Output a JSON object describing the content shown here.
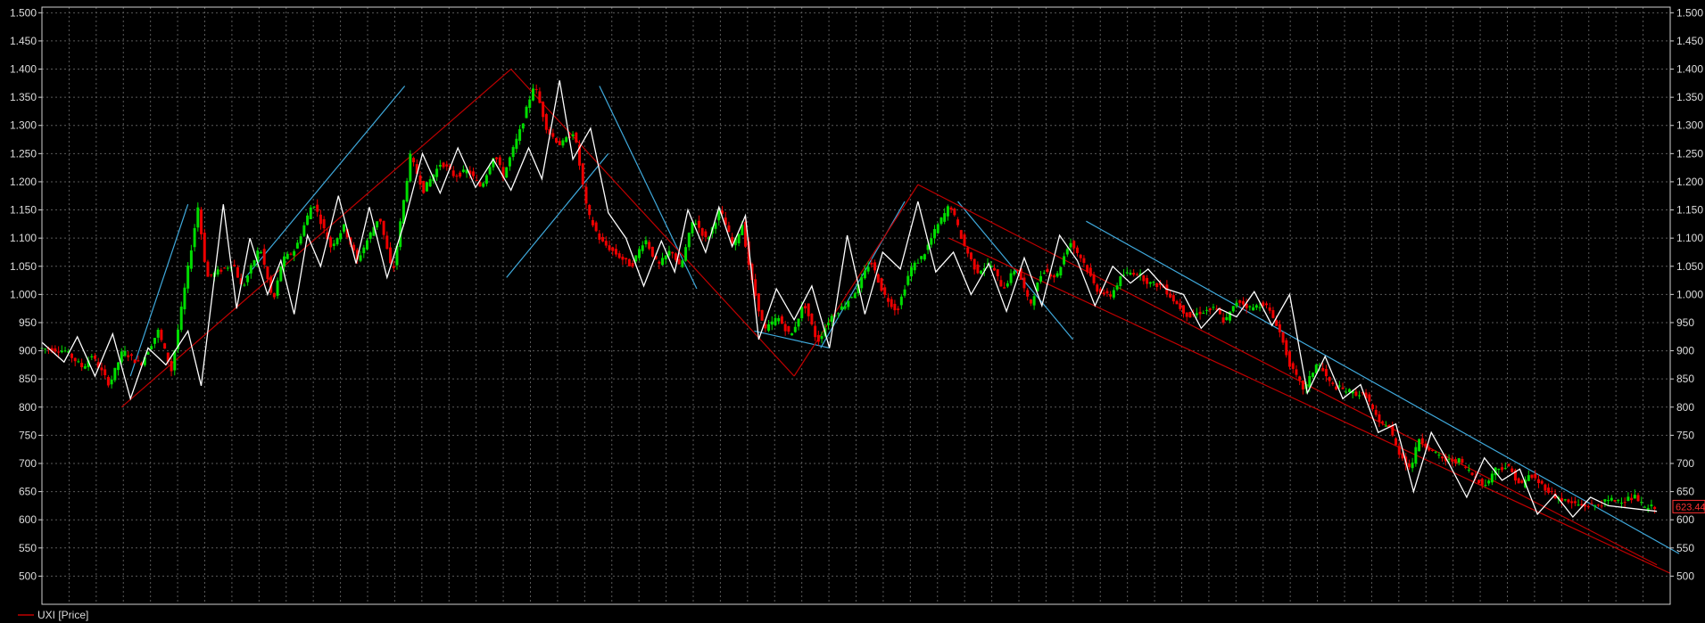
{
  "legend": {
    "label": "UXI [Price]",
    "color": "#c00000"
  },
  "colors": {
    "background": "#000000",
    "grid": "#5a5a5a",
    "axis": "#d0d0d0",
    "up_candle": "#00dd00",
    "down_candle": "#ee0000",
    "zigzag": "#ffffff",
    "trend_blue": "#3fa9dc",
    "trend_red": "#c00000",
    "price_label": "#ff3030"
  },
  "chart_data": {
    "type": "candlestick",
    "series_name": "UXI [Price]",
    "ylim": [
      450,
      1510
    ],
    "yticks": [
      500,
      550,
      600,
      650,
      700,
      750,
      800,
      850,
      900,
      950,
      1000,
      1050,
      1100,
      1150,
      1200,
      1250,
      1300,
      1350,
      1400,
      1450,
      1500
    ],
    "ytick_labels": [
      "500",
      "550",
      "600",
      "650",
      "700",
      "750",
      "800",
      "850",
      "900",
      "950",
      "1.000",
      "1.050",
      "1.100",
      "1.150",
      "1.200",
      "1.250",
      "1.300",
      "1.350",
      "1.400",
      "1.450",
      "1.500"
    ],
    "x_range": [
      0,
      300
    ],
    "x_grid_count": 59,
    "grid": true,
    "last_price": 623.44,
    "last_price_label": "623.44",
    "price_path": [
      [
        0,
        905
      ],
      [
        6,
        900
      ],
      [
        10,
        870
      ],
      [
        12,
        892
      ],
      [
        16,
        840
      ],
      [
        19,
        900
      ],
      [
        23,
        875
      ],
      [
        27,
        935
      ],
      [
        30,
        865
      ],
      [
        36,
        1155
      ],
      [
        38,
        1030
      ],
      [
        44,
        1055
      ],
      [
        46,
        1010
      ],
      [
        50,
        1085
      ],
      [
        53,
        985
      ],
      [
        55,
        1060
      ],
      [
        58,
        1080
      ],
      [
        62,
        1165
      ],
      [
        66,
        1085
      ],
      [
        69,
        1120
      ],
      [
        72,
        1060
      ],
      [
        77,
        1140
      ],
      [
        80,
        1035
      ],
      [
        84,
        1245
      ],
      [
        87,
        1185
      ],
      [
        91,
        1235
      ],
      [
        94,
        1210
      ],
      [
        97,
        1220
      ],
      [
        100,
        1190
      ],
      [
        103,
        1250
      ],
      [
        105,
        1210
      ],
      [
        109,
        1295
      ],
      [
        112,
        1375
      ],
      [
        115,
        1290
      ],
      [
        118,
        1265
      ],
      [
        121,
        1290
      ],
      [
        124,
        1145
      ],
      [
        127,
        1095
      ],
      [
        130,
        1075
      ],
      [
        134,
        1050
      ],
      [
        137,
        1100
      ],
      [
        140,
        1050
      ],
      [
        143,
        1080
      ],
      [
        145,
        1045
      ],
      [
        148,
        1135
      ],
      [
        151,
        1095
      ],
      [
        154,
        1150
      ],
      [
        157,
        1085
      ],
      [
        159,
        1125
      ],
      [
        161,
        1030
      ],
      [
        164,
        935
      ],
      [
        167,
        960
      ],
      [
        170,
        925
      ],
      [
        173,
        985
      ],
      [
        176,
        915
      ],
      [
        179,
        960
      ],
      [
        182,
        980
      ],
      [
        185,
        1010
      ],
      [
        188,
        1060
      ],
      [
        191,
        1000
      ],
      [
        194,
        970
      ],
      [
        197,
        1045
      ],
      [
        200,
        1070
      ],
      [
        203,
        1120
      ],
      [
        206,
        1160
      ],
      [
        209,
        1090
      ],
      [
        212,
        1040
      ],
      [
        215,
        1055
      ],
      [
        218,
        1010
      ],
      [
        221,
        1050
      ],
      [
        224,
        980
      ],
      [
        227,
        1045
      ],
      [
        230,
        1030
      ],
      [
        233,
        1095
      ],
      [
        236,
        1060
      ],
      [
        239,
        1010
      ],
      [
        242,
        995
      ],
      [
        245,
        1035
      ],
      [
        248,
        1040
      ],
      [
        251,
        1020
      ],
      [
        254,
        1015
      ],
      [
        257,
        985
      ],
      [
        260,
        960
      ],
      [
        263,
        970
      ],
      [
        266,
        975
      ],
      [
        268,
        950
      ],
      [
        271,
        990
      ],
      [
        274,
        975
      ],
      [
        277,
        985
      ],
      [
        280,
        945
      ],
      [
        283,
        870
      ],
      [
        286,
        830
      ],
      [
        289,
        880
      ],
      [
        292,
        840
      ],
      [
        295,
        830
      ],
      [
        300,
        820
      ],
      [
        303,
        770
      ],
      [
        305,
        770
      ],
      [
        307,
        725
      ],
      [
        310,
        690
      ],
      [
        312,
        745
      ],
      [
        315,
        720
      ],
      [
        318,
        705
      ],
      [
        321,
        705
      ],
      [
        324,
        680
      ],
      [
        327,
        660
      ],
      [
        329,
        690
      ],
      [
        332,
        695
      ],
      [
        335,
        660
      ],
      [
        337,
        680
      ],
      [
        340,
        660
      ],
      [
        343,
        640
      ],
      [
        346,
        630
      ],
      [
        349,
        625
      ],
      [
        352,
        625
      ],
      [
        355,
        635
      ],
      [
        358,
        635
      ],
      [
        361,
        640
      ],
      [
        363,
        620
      ],
      [
        365,
        623
      ]
    ],
    "zigzag": [
      [
        0,
        915
      ],
      [
        5,
        880
      ],
      [
        8,
        925
      ],
      [
        12,
        855
      ],
      [
        16,
        930
      ],
      [
        20,
        815
      ],
      [
        24,
        905
      ],
      [
        28,
        875
      ],
      [
        33,
        935
      ],
      [
        36,
        838
      ],
      [
        41,
        1160
      ],
      [
        44,
        975
      ],
      [
        47,
        1100
      ],
      [
        51,
        1000
      ],
      [
        54,
        1060
      ],
      [
        57,
        965
      ],
      [
        60,
        1105
      ],
      [
        63,
        1050
      ],
      [
        67,
        1175
      ],
      [
        71,
        1055
      ],
      [
        74,
        1155
      ],
      [
        78,
        1030
      ],
      [
        82,
        1130
      ],
      [
        86,
        1250
      ],
      [
        90,
        1180
      ],
      [
        94,
        1260
      ],
      [
        98,
        1190
      ],
      [
        102,
        1240
      ],
      [
        106,
        1185
      ],
      [
        110,
        1260
      ],
      [
        113,
        1205
      ],
      [
        117,
        1380
      ],
      [
        120,
        1240
      ],
      [
        124,
        1295
      ],
      [
        128,
        1145
      ],
      [
        132,
        1100
      ],
      [
        136,
        1015
      ],
      [
        140,
        1095
      ],
      [
        143,
        1040
      ],
      [
        146,
        1150
      ],
      [
        150,
        1075
      ],
      [
        153,
        1155
      ],
      [
        156,
        1085
      ],
      [
        159,
        1140
      ],
      [
        162,
        920
      ],
      [
        166,
        1010
      ],
      [
        170,
        955
      ],
      [
        174,
        1015
      ],
      [
        178,
        905
      ],
      [
        182,
        1105
      ],
      [
        186,
        965
      ],
      [
        190,
        1075
      ],
      [
        194,
        1045
      ],
      [
        198,
        1165
      ],
      [
        202,
        1040
      ],
      [
        206,
        1075
      ],
      [
        210,
        1000
      ],
      [
        214,
        1055
      ],
      [
        218,
        970
      ],
      [
        222,
        1065
      ],
      [
        226,
        980
      ],
      [
        230,
        1105
      ],
      [
        234,
        1060
      ],
      [
        238,
        980
      ],
      [
        242,
        1050
      ],
      [
        246,
        1020
      ],
      [
        250,
        1045
      ],
      [
        254,
        1010
      ],
      [
        258,
        1000
      ],
      [
        262,
        940
      ],
      [
        266,
        975
      ],
      [
        270,
        960
      ],
      [
        274,
        1005
      ],
      [
        278,
        945
      ],
      [
        282,
        1000
      ],
      [
        286,
        825
      ],
      [
        290,
        890
      ],
      [
        294,
        815
      ],
      [
        298,
        840
      ],
      [
        302,
        755
      ],
      [
        306,
        770
      ],
      [
        310,
        650
      ],
      [
        314,
        755
      ],
      [
        318,
        700
      ],
      [
        322,
        640
      ],
      [
        326,
        710
      ],
      [
        330,
        670
      ],
      [
        334,
        690
      ],
      [
        338,
        610
      ],
      [
        342,
        645
      ],
      [
        346,
        605
      ],
      [
        350,
        640
      ],
      [
        354,
        625
      ],
      [
        365,
        615
      ]
    ],
    "trendlines": [
      {
        "color": "blue",
        "points": [
          [
            20,
            855
          ],
          [
            33,
            1160
          ]
        ]
      },
      {
        "color": "blue",
        "points": [
          [
            46,
            1030
          ],
          [
            82,
            1370
          ]
        ]
      },
      {
        "color": "blue",
        "points": [
          [
            105,
            1030
          ],
          [
            128,
            1250
          ]
        ]
      },
      {
        "color": "blue",
        "points": [
          [
            126,
            1370
          ],
          [
            148,
            1010
          ]
        ]
      },
      {
        "color": "blue",
        "points": [
          [
            161,
            935
          ],
          [
            178,
            905
          ]
        ]
      },
      {
        "color": "blue",
        "points": [
          [
            176,
            905
          ],
          [
            195,
            1165
          ]
        ]
      },
      {
        "color": "blue",
        "points": [
          [
            207,
            1165
          ],
          [
            233,
            920
          ]
        ]
      },
      {
        "color": "blue",
        "points": [
          [
            236,
            1130
          ],
          [
            370,
            540
          ]
        ]
      },
      {
        "color": "red",
        "points": [
          [
            18,
            800
          ],
          [
            106,
            1400
          ]
        ]
      },
      {
        "color": "red",
        "points": [
          [
            106,
            1400
          ],
          [
            170,
            855
          ]
        ]
      },
      {
        "color": "red",
        "points": [
          [
            170,
            855
          ],
          [
            198,
            1195
          ]
        ]
      },
      {
        "color": "red",
        "points": [
          [
            198,
            1195
          ],
          [
            365,
            520
          ]
        ]
      },
      {
        "color": "red",
        "points": [
          [
            205,
            1100
          ],
          [
            368,
            505
          ]
        ]
      }
    ]
  }
}
